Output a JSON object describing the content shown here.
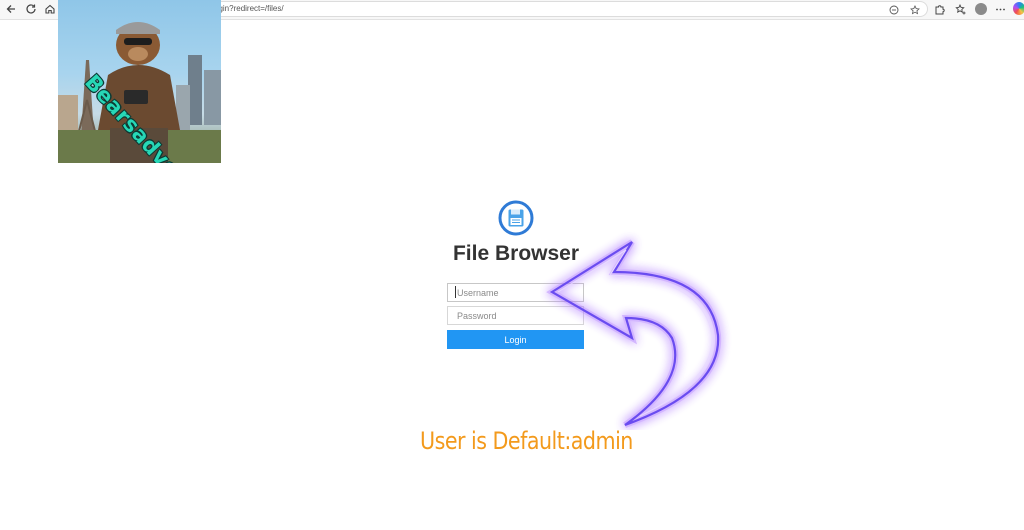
{
  "browser": {
    "url_fragment": "ogin?redirect=/files/",
    "icons": [
      "back-arrow-icon",
      "reload-icon",
      "home-icon",
      "reader-icon",
      "favorite-star-icon",
      "extensions-icon",
      "favorites-icon",
      "profile-avatar-icon",
      "more-icon",
      "copilot-icon"
    ]
  },
  "sticker": {
    "text": "Bearsadventures"
  },
  "login": {
    "logo_icon": "floppy-disk-icon",
    "title": "File Browser",
    "username_placeholder": "Username",
    "password_placeholder": "Password",
    "button_label": "Login",
    "button_color": "#2196f3"
  },
  "annotation": {
    "text": "User is Default:admin",
    "text_color": "#f39a1c",
    "arrow_color": "#a86bff"
  }
}
